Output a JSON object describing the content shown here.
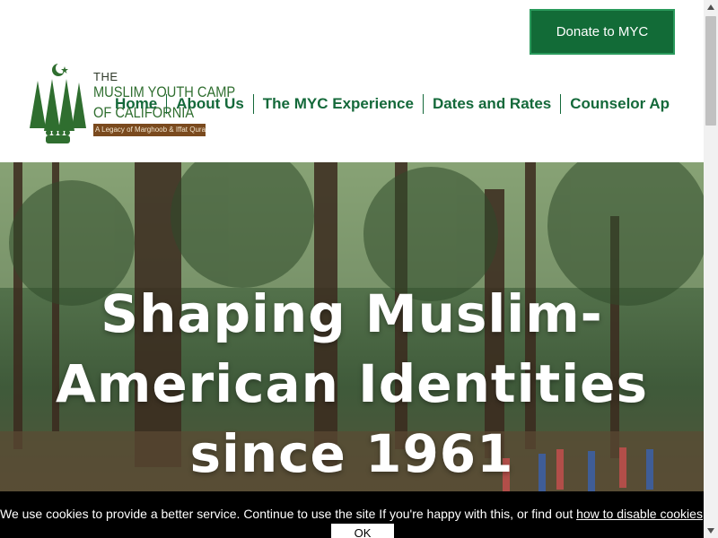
{
  "header": {
    "donate_label": "Donate to MYC",
    "logo": {
      "the": "THE",
      "line1": "MUSLIM YOUTH CAMP",
      "line2": "OF CALIFORNIA",
      "tagline": "A Legacy of Marghoob & Iffat Quraishi"
    },
    "nav": [
      {
        "label": "Home"
      },
      {
        "label": "About Us"
      },
      {
        "label": "The MYC Experience"
      },
      {
        "label": "Dates and Rates"
      },
      {
        "label": "Counselor Ap"
      }
    ]
  },
  "hero": {
    "line1": "Shaping Muslim-",
    "line2": "American Identities",
    "line3": "since 1961"
  },
  "cookie": {
    "text": "We use cookies to provide a better service. Continue to use the site If you're happy with this, or find out ",
    "link": "how to disable cookies",
    "end": ".",
    "ok": "OK"
  },
  "colors": {
    "brand_green": "#126b37",
    "nav_green": "#14693a",
    "tag_brown": "#7a4a1e"
  }
}
